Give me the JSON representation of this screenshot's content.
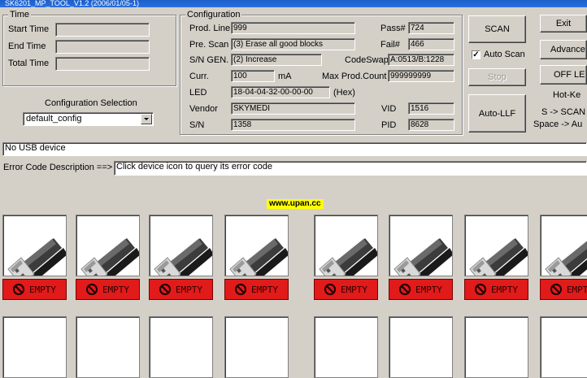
{
  "window": {
    "title": "SK6201_MP_TOOL_V1.2 (2006/01/05-1)"
  },
  "time_group": {
    "legend": "Time",
    "start_label": "Start Time",
    "end_label": "End Time",
    "total_label": "Total Time"
  },
  "config_selection": {
    "label": "Configuration Selection",
    "value": "default_config"
  },
  "config_group": {
    "legend": "Configuration",
    "prod_line_label": "Prod. Line",
    "prod_line": "999",
    "pre_scan_label": "Pre. Scan",
    "pre_scan": "(3) Erase all good blocks",
    "sn_gen_label": "S/N GEN.",
    "sn_gen": "(2) Increase",
    "curr_label": "Curr.",
    "curr": "100",
    "curr_unit": "mA",
    "led_label": "LED",
    "led": "18-04-04-32-00-00-00",
    "led_unit": "(Hex)",
    "vendor_label": "Vendor",
    "vendor": "SKYMEDI",
    "sn_label": "S/N",
    "sn": "1358",
    "pass_label": "Pass#",
    "pass": "724",
    "fail_label": "Fail#",
    "fail": "466",
    "codeswap_label": "CodeSwap",
    "codeswap": "A:0513/B:1228",
    "max_prod_label": "Max Prod.Count",
    "max_prod": "999999999",
    "vid_label": "VID",
    "vid": "1516",
    "pid_label": "PID",
    "pid": "8628"
  },
  "buttons": {
    "scan": "SCAN",
    "auto_scan": "Auto Scan",
    "auto_scan_checked": "✓",
    "stop": "Stop",
    "auto_llf": "Auto-LLF",
    "exit": "Exit",
    "advance": "Advance",
    "off_led": "OFF LE"
  },
  "hotkey": {
    "title": "Hot-Ke",
    "line1": "S -> SCAN",
    "line2": "Space -> Au"
  },
  "status_line": "No USB device",
  "error_code": {
    "label": "Error Code Description ==>",
    "value": "Click device icon to query its error code"
  },
  "watermark": "www.upan.cc",
  "slots": [
    {
      "status": "EMPTY"
    },
    {
      "status": "EMPTY"
    },
    {
      "status": "EMPTY"
    },
    {
      "status": "EMPTY"
    },
    {
      "status": "EMPTY"
    },
    {
      "status": "EMPTY"
    },
    {
      "status": "EMPTY"
    },
    {
      "status": "EMPTY"
    }
  ]
}
